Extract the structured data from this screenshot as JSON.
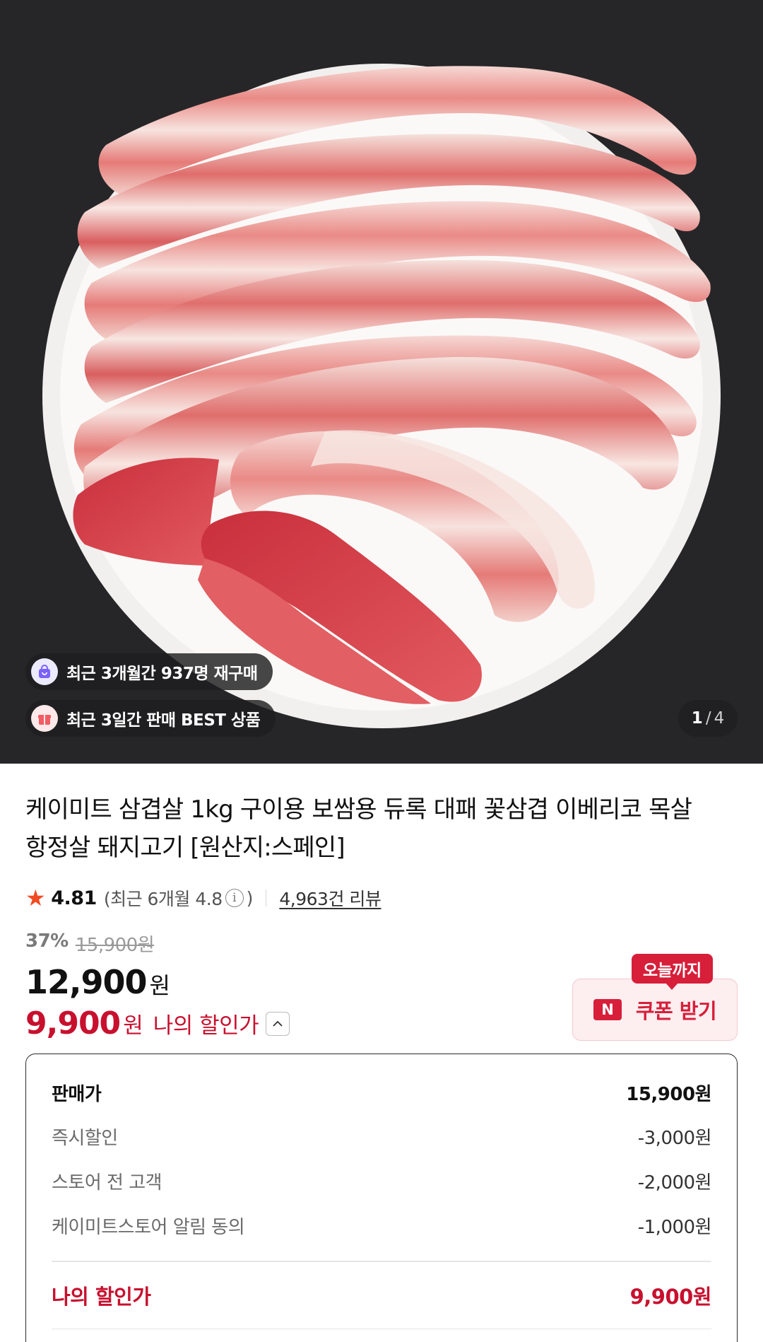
{
  "hero": {
    "image_alt": "삼겹살 상품 이미지",
    "badges": [
      {
        "text": "최근 3개월간 937명 재구매",
        "icon": "shopping-bag-icon",
        "icon_color": "#7b61ff"
      },
      {
        "text": "최근 3일간 판매 BEST 상품",
        "icon": "gift-box-icon",
        "icon_color": "#f25c63"
      }
    ],
    "counter": {
      "current": "1",
      "separator": "/",
      "total": "4"
    }
  },
  "product": {
    "title": "케이미트 삼겹살 1kg 구이용 보쌈용 듀록 대패 꽃삼겹 이베리코 목살 항정살 돼지고기 [원산지:스페인]",
    "rating": "4.81",
    "recent_rating_label": "(최근 6개월 4.8",
    "recent_rating_close": ")",
    "review_count": "4,963건 리뷰",
    "discount_percent": "37%",
    "original_price": "15,900원",
    "price": "12,900",
    "price_unit": "원",
    "my_price": "9,900",
    "my_price_unit": "원",
    "my_price_label": "나의 할인가"
  },
  "coupon": {
    "badge": "오늘까지",
    "button_label": "쿠폰 받기",
    "brand_letter": "N"
  },
  "breakdown": {
    "rows": [
      {
        "label": "판매가",
        "amount": "15,900원"
      },
      {
        "label": "즉시할인",
        "amount": "-3,000원"
      },
      {
        "label": "스토어 전 고객",
        "amount": "-2,000원"
      },
      {
        "label": "케이미트스토어 알림 동의",
        "amount": "-1,000원"
      }
    ],
    "total_label": "나의 할인가",
    "total_amount": "9,900원"
  },
  "colors": {
    "accent_red": "#c8102e",
    "star": "#f04b23",
    "hero_bg": "#262628"
  }
}
